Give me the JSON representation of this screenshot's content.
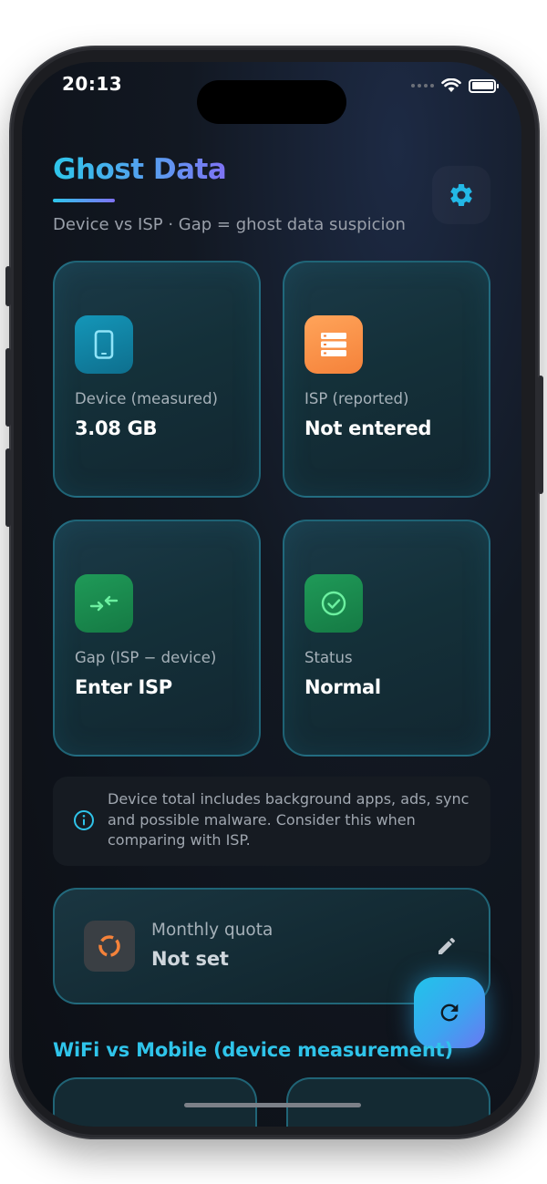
{
  "status_bar": {
    "time": "20:13"
  },
  "header": {
    "title": "Ghost Data",
    "subtitle": "Device vs ISP · Gap = ghost data suspicion"
  },
  "cards": [
    {
      "label": "Device (measured)",
      "value": "3.08 GB",
      "icon": "phone-icon",
      "icon_bg": "#1488a8"
    },
    {
      "label": "ISP (reported)",
      "value": "Not entered",
      "icon": "server-icon",
      "icon_bg": "#f7924a"
    },
    {
      "label": "Gap (ISP − device)",
      "value": "Enter ISP",
      "icon": "compare-arrows-icon",
      "icon_bg": "#1a8a4e"
    },
    {
      "label": "Status",
      "value": "Normal",
      "icon": "check-circle-icon",
      "icon_bg": "#1a8a4e"
    }
  ],
  "info": {
    "text": "Device total includes background apps, ads, sync and possible malware. Consider this when comparing with ISP."
  },
  "quota": {
    "label": "Monthly quota",
    "value": "Not set",
    "icon": "donut-icon"
  },
  "section": {
    "title": "WiFi vs Mobile (device measurement)"
  },
  "colors": {
    "accent": "#2fc4ea",
    "accent_end": "#7f72f4",
    "ok_green": "#1a8a4e",
    "warn_orange": "#f7924a"
  }
}
